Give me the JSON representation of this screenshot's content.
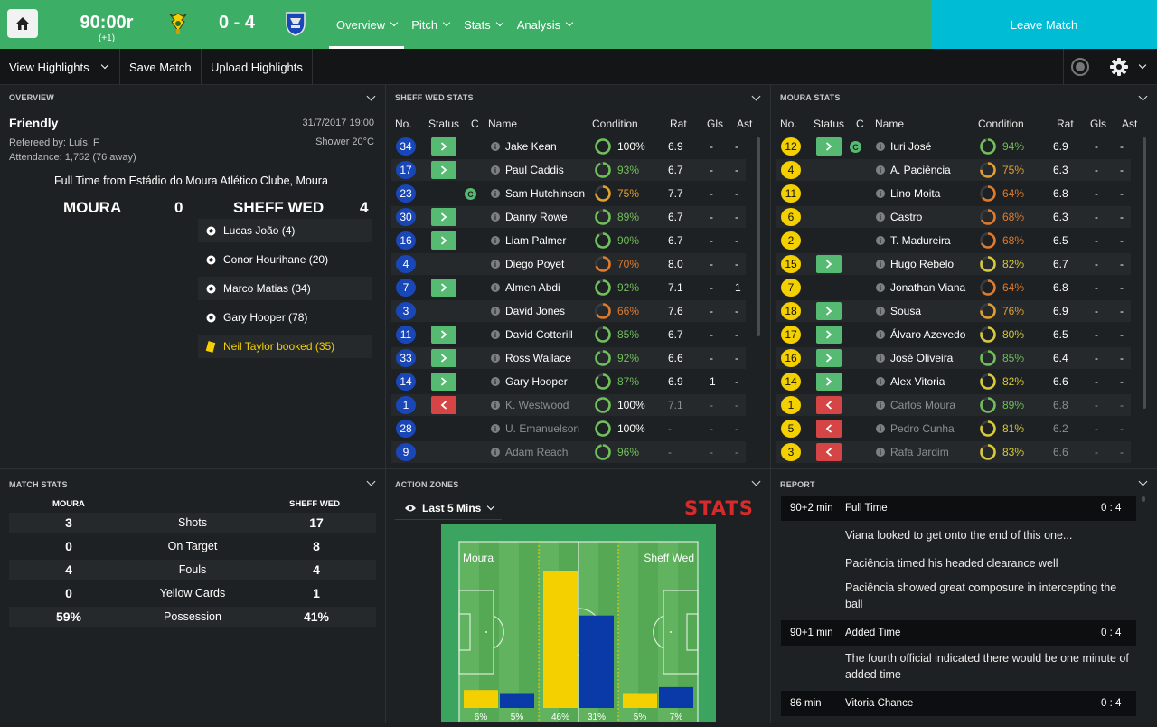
{
  "topbar": {
    "clock": "90:00r",
    "clock_extra": "(+1)",
    "score": "0 - 4",
    "tabs": [
      "Overview",
      "Pitch",
      "Stats",
      "Analysis"
    ],
    "leave": "Leave Match"
  },
  "toolbar": {
    "view_highlights": "View Highlights",
    "save": "Save Match",
    "upload": "Upload Highlights"
  },
  "overview": {
    "header": "OVERVIEW",
    "type": "Friendly",
    "datetime": "31/7/2017 19:00",
    "referee": "Refereed by: Luís, F",
    "weather": "Shower 20°C",
    "attendance": "Attendance: 1,752 (76 away)",
    "fulltime": "Full Time from Estádio do Moura Atlético Clube, Moura",
    "home": "MOURA",
    "home_score": "0",
    "away": "SHEFF WED",
    "away_score": "4",
    "events": [
      {
        "icon": "ball-icon",
        "text": "Lucas João (4)"
      },
      {
        "icon": "ball-icon",
        "text": "Conor Hourihane (20)"
      },
      {
        "icon": "ball-icon",
        "text": "Marco Matias (34)"
      },
      {
        "icon": "ball-icon",
        "text": "Gary Hooper (78)"
      },
      {
        "icon": "yellow-card-icon",
        "text": "Neil Taylor booked (35)"
      }
    ]
  },
  "columns": {
    "no": "No.",
    "status": "Status",
    "c": "C",
    "name": "Name",
    "condition": "Condition",
    "rat": "Rat",
    "gls": "Gls",
    "ast": "Ast"
  },
  "sheff": {
    "header": "SHEFF WED STATS",
    "color": "#1a47b8",
    "players": [
      {
        "no": "34",
        "status": "in",
        "cap": false,
        "name": "Jake Kean",
        "cond": 100,
        "cond_txt": "100%",
        "rat": "6.9",
        "gls": "-",
        "ast": "-",
        "dim": false
      },
      {
        "no": "17",
        "status": "in",
        "cap": false,
        "name": "Paul Caddis",
        "cond": 93,
        "cond_txt": "93%",
        "rat": "6.7",
        "gls": "-",
        "ast": "-",
        "dim": false
      },
      {
        "no": "23",
        "status": "",
        "cap": true,
        "name": "Sam Hutchinson",
        "cond": 75,
        "cond_txt": "75%",
        "rat": "7.7",
        "gls": "-",
        "ast": "-",
        "dim": false
      },
      {
        "no": "30",
        "status": "in",
        "cap": false,
        "name": "Danny Rowe",
        "cond": 89,
        "cond_txt": "89%",
        "rat": "6.7",
        "gls": "-",
        "ast": "-",
        "dim": false
      },
      {
        "no": "16",
        "status": "in",
        "cap": false,
        "name": "Liam Palmer",
        "cond": 90,
        "cond_txt": "90%",
        "rat": "6.7",
        "gls": "-",
        "ast": "-",
        "dim": false
      },
      {
        "no": "4",
        "status": "",
        "cap": false,
        "name": "Diego Poyet",
        "cond": 70,
        "cond_txt": "70%",
        "rat": "8.0",
        "gls": "-",
        "ast": "-",
        "dim": false
      },
      {
        "no": "7",
        "status": "in",
        "cap": false,
        "name": "Almen Abdi",
        "cond": 92,
        "cond_txt": "92%",
        "rat": "7.1",
        "gls": "-",
        "ast": "1",
        "dim": false
      },
      {
        "no": "3",
        "status": "",
        "cap": false,
        "name": "David Jones",
        "cond": 66,
        "cond_txt": "66%",
        "rat": "7.6",
        "gls": "-",
        "ast": "-",
        "dim": false
      },
      {
        "no": "11",
        "status": "in",
        "cap": false,
        "name": "David Cotterill",
        "cond": 85,
        "cond_txt": "85%",
        "rat": "6.7",
        "gls": "-",
        "ast": "-",
        "dim": false
      },
      {
        "no": "33",
        "status": "in",
        "cap": false,
        "name": "Ross Wallace",
        "cond": 92,
        "cond_txt": "92%",
        "rat": "6.6",
        "gls": "-",
        "ast": "-",
        "dim": false
      },
      {
        "no": "14",
        "status": "in",
        "cap": false,
        "name": "Gary Hooper",
        "cond": 87,
        "cond_txt": "87%",
        "rat": "6.9",
        "gls": "1",
        "ast": "-",
        "dim": false
      },
      {
        "no": "1",
        "status": "out",
        "cap": false,
        "name": "K. Westwood",
        "cond": 100,
        "cond_txt": "100%",
        "rat": "7.1",
        "gls": "-",
        "ast": "-",
        "dim": true
      },
      {
        "no": "28",
        "status": "",
        "cap": false,
        "name": "U. Emanuelson",
        "cond": 100,
        "cond_txt": "100%",
        "rat": "-",
        "gls": "-",
        "ast": "-",
        "dim": true
      },
      {
        "no": "9",
        "status": "",
        "cap": false,
        "name": "Adam Reach",
        "cond": 96,
        "cond_txt": "96%",
        "rat": "-",
        "gls": "-",
        "ast": "-",
        "dim": true
      }
    ]
  },
  "moura": {
    "header": "MOURA STATS",
    "color": "#f4d000",
    "players": [
      {
        "no": "12",
        "status": "in",
        "cap": true,
        "name": "Iuri José",
        "cond": 94,
        "cond_txt": "94%",
        "rat": "6.9",
        "gls": "-",
        "ast": "-",
        "dim": false
      },
      {
        "no": "4",
        "status": "",
        "cap": false,
        "name": "A. Paciência",
        "cond": 75,
        "cond_txt": "75%",
        "rat": "6.3",
        "gls": "-",
        "ast": "-",
        "dim": false
      },
      {
        "no": "11",
        "status": "",
        "cap": false,
        "name": "Lino Moita",
        "cond": 64,
        "cond_txt": "64%",
        "rat": "6.8",
        "gls": "-",
        "ast": "-",
        "dim": false
      },
      {
        "no": "6",
        "status": "",
        "cap": false,
        "name": "Castro",
        "cond": 68,
        "cond_txt": "68%",
        "rat": "6.3",
        "gls": "-",
        "ast": "-",
        "dim": false
      },
      {
        "no": "2",
        "status": "",
        "cap": false,
        "name": "T. Madureira",
        "cond": 68,
        "cond_txt": "68%",
        "rat": "6.5",
        "gls": "-",
        "ast": "-",
        "dim": false
      },
      {
        "no": "15",
        "status": "in",
        "cap": false,
        "name": "Hugo Rebelo",
        "cond": 82,
        "cond_txt": "82%",
        "rat": "6.7",
        "gls": "-",
        "ast": "-",
        "dim": false
      },
      {
        "no": "7",
        "status": "",
        "cap": false,
        "name": "Jonathan Viana",
        "cond": 64,
        "cond_txt": "64%",
        "rat": "6.8",
        "gls": "-",
        "ast": "-",
        "dim": false
      },
      {
        "no": "18",
        "status": "in",
        "cap": false,
        "name": "Sousa",
        "cond": 76,
        "cond_txt": "76%",
        "rat": "6.9",
        "gls": "-",
        "ast": "-",
        "dim": false
      },
      {
        "no": "17",
        "status": "in",
        "cap": false,
        "name": "Álvaro Azevedo",
        "cond": 80,
        "cond_txt": "80%",
        "rat": "6.5",
        "gls": "-",
        "ast": "-",
        "dim": false
      },
      {
        "no": "16",
        "status": "in",
        "cap": false,
        "name": "José Oliveira",
        "cond": 85,
        "cond_txt": "85%",
        "rat": "6.4",
        "gls": "-",
        "ast": "-",
        "dim": false
      },
      {
        "no": "14",
        "status": "in",
        "cap": false,
        "name": "Alex Vitoria",
        "cond": 82,
        "cond_txt": "82%",
        "rat": "6.6",
        "gls": "-",
        "ast": "-",
        "dim": false
      },
      {
        "no": "1",
        "status": "out",
        "cap": false,
        "name": "Carlos Moura",
        "cond": 89,
        "cond_txt": "89%",
        "rat": "6.8",
        "gls": "-",
        "ast": "-",
        "dim": true
      },
      {
        "no": "5",
        "status": "out",
        "cap": false,
        "name": "Pedro Cunha",
        "cond": 81,
        "cond_txt": "81%",
        "rat": "6.2",
        "gls": "-",
        "ast": "-",
        "dim": true
      },
      {
        "no": "3",
        "status": "out",
        "cap": false,
        "name": "Rafa Jardim",
        "cond": 83,
        "cond_txt": "83%",
        "rat": "6.6",
        "gls": "-",
        "ast": "-",
        "dim": true
      }
    ]
  },
  "match_stats": {
    "header": "MATCH STATS",
    "home": "MOURA",
    "away": "SHEFF WED",
    "rows": [
      {
        "h": "3",
        "label": "Shots",
        "a": "17"
      },
      {
        "h": "0",
        "label": "On Target",
        "a": "8"
      },
      {
        "h": "4",
        "label": "Fouls",
        "a": "4"
      },
      {
        "h": "0",
        "label": "Yellow Cards",
        "a": "1"
      },
      {
        "h": "59%",
        "label": "Possession",
        "a": "41%"
      }
    ]
  },
  "action_zones": {
    "header": "ACTION ZONES",
    "filter": "Last 5 Mins",
    "brand": "STATS",
    "home": "Moura",
    "away": "Sheff Wed",
    "home_color": "#f4d000",
    "away_color": "#0a3aa8",
    "zones": [
      {
        "home": 6,
        "away": 5,
        "home_txt": "6%",
        "away_txt": "5%"
      },
      {
        "home": 46,
        "away": 31,
        "home_txt": "46%",
        "away_txt": "31%"
      },
      {
        "home": 5,
        "away": 7,
        "home_txt": "5%",
        "away_txt": "7%"
      }
    ]
  },
  "report": {
    "header": "REPORT",
    "items": [
      {
        "type": "head",
        "time": "90+2 min",
        "title": "Full Time",
        "score": "0 : 4"
      },
      {
        "type": "text",
        "text": "Viana looked to get onto the end of this one..."
      },
      {
        "type": "text",
        "text": "Paciência timed his headed clearance well"
      },
      {
        "type": "text",
        "text": "Paciência showed great composure in intercepting the ball"
      },
      {
        "type": "head",
        "time": "90+1 min",
        "title": "Added Time",
        "score": "0 : 4"
      },
      {
        "type": "text",
        "text": "The fourth official indicated there would be one minute of added time"
      },
      {
        "type": "head",
        "time": "86 min",
        "title": "Vitoria Chance",
        "score": "0 : 4"
      }
    ]
  }
}
